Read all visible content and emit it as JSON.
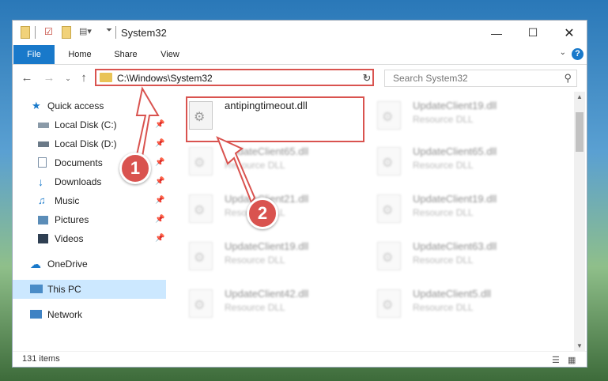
{
  "window": {
    "title": "System32"
  },
  "ribbon": {
    "tabs": [
      "File",
      "Home",
      "Share",
      "View"
    ],
    "help": "?"
  },
  "nav": {
    "address": "C:\\Windows\\System32",
    "search_placeholder": "Search System32"
  },
  "sidebar": {
    "items": [
      {
        "label": "Quick access",
        "icon": "star-icon"
      },
      {
        "label": "Local Disk (C:)",
        "icon": "drive-icon"
      },
      {
        "label": "Local Disk (D:)",
        "icon": "drive-icon"
      },
      {
        "label": "Documents",
        "icon": "documents-icon"
      },
      {
        "label": "Downloads",
        "icon": "download-icon"
      },
      {
        "label": "Music",
        "icon": "music-icon"
      },
      {
        "label": "Pictures",
        "icon": "pictures-icon"
      },
      {
        "label": "Videos",
        "icon": "videos-icon"
      },
      {
        "label": "OneDrive",
        "icon": "cloud-icon"
      },
      {
        "label": "This PC",
        "icon": "pc-icon"
      },
      {
        "label": "Network",
        "icon": "network-icon"
      }
    ]
  },
  "files": {
    "highlighted": {
      "name": "antipingtimeout.dll",
      "type": ""
    },
    "left": [
      {
        "name": "UpdateClient65.dll",
        "type": "Resource DLL"
      },
      {
        "name": "UpdateClient21.dll",
        "type": "Resource DLL"
      },
      {
        "name": "UpdateClient19.dll",
        "type": "Resource DLL"
      },
      {
        "name": "UpdateClient42.dll",
        "type": "Resource DLL"
      }
    ],
    "right": [
      {
        "name": "UpdateClient19.dll",
        "type": "Resource DLL"
      },
      {
        "name": "UpdateClient65.dll",
        "type": "Resource DLL"
      },
      {
        "name": "UpdateClient19.dll",
        "type": "Resource DLL"
      },
      {
        "name": "UpdateClient63.dll",
        "type": "Resource DLL"
      },
      {
        "name": "UpdateClient5.dll",
        "type": "Resource DLL"
      }
    ]
  },
  "status": {
    "count": "131 items"
  },
  "annotations": {
    "step1": "1",
    "step2": "2"
  },
  "colors": {
    "accent": "#1979ca",
    "annotation": "#d9534f",
    "selected": "#cce8ff"
  }
}
